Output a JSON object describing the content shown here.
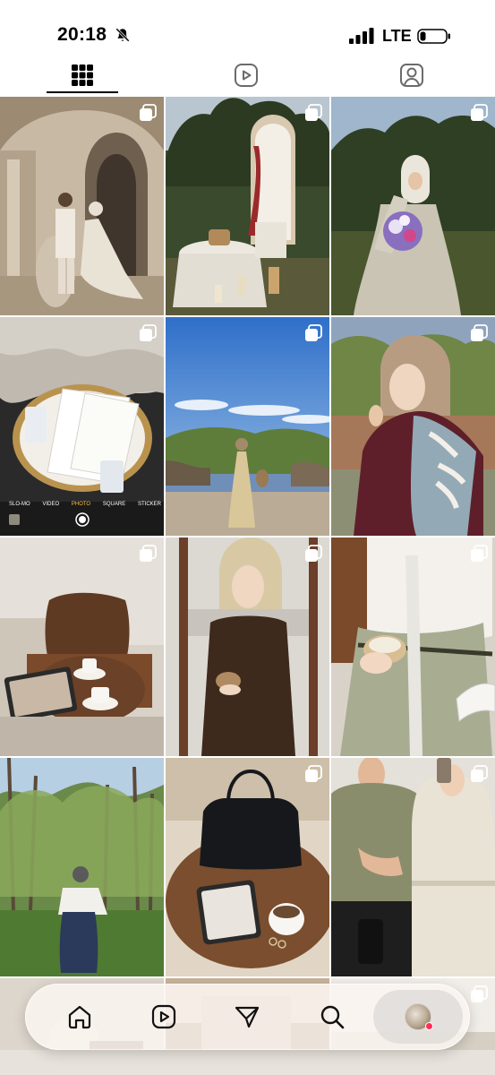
{
  "status_bar": {
    "time": "20:18",
    "network": "LTE",
    "icons": [
      "bell-slash-icon",
      "signal-bars-icon",
      "battery-icon"
    ]
  },
  "profile_tabs": {
    "items": [
      {
        "id": "grid",
        "icon": "grid-icon",
        "selected": true
      },
      {
        "id": "reels",
        "icon": "reels-icon",
        "selected": false
      },
      {
        "id": "tagged",
        "icon": "tagged-icon",
        "selected": false
      }
    ]
  },
  "grid": {
    "posts": [
      {
        "scene": "couple-in-cave-chamber",
        "multiple": true
      },
      {
        "scene": "wedding-arch-table-lanterns",
        "multiple": true
      },
      {
        "scene": "woman-with-bouquet",
        "multiple": true
      },
      {
        "scene": "invitation-on-gold-tray",
        "multiple": true,
        "caption_strip": [
          "SLO-MO",
          "VIDEO",
          "PHOTO",
          "SQUARE",
          "STICKER"
        ]
      },
      {
        "scene": "woman-by-river-blue-sky",
        "multiple": true
      },
      {
        "scene": "woman-with-patterned-scarf",
        "multiple": true
      },
      {
        "scene": "coffee-cups-leather-chair",
        "multiple": true
      },
      {
        "scene": "woman-in-brown-dress-cafe",
        "multiple": true
      },
      {
        "scene": "coffee-pleated-skirt",
        "multiple": true
      },
      {
        "scene": "woman-in-forest",
        "multiple": false
      },
      {
        "scene": "black-bag-tablet-coffee",
        "multiple": true
      },
      {
        "scene": "couple-mirror-selfie",
        "multiple": true
      },
      {
        "scene": "partial-row-1",
        "multiple": false
      },
      {
        "scene": "partial-row-2",
        "multiple": false
      },
      {
        "scene": "partial-row-3",
        "multiple": true
      }
    ]
  },
  "bottom_nav": {
    "items": [
      {
        "id": "home",
        "icon": "home-icon"
      },
      {
        "id": "reels",
        "icon": "reels-icon"
      },
      {
        "id": "messages",
        "icon": "paper-plane-icon"
      },
      {
        "id": "search",
        "icon": "search-icon"
      },
      {
        "id": "profile",
        "icon": "avatar",
        "has_notification": true
      }
    ]
  },
  "colors": {
    "notification": "#ff2d55",
    "tab_indicator": "#000000"
  }
}
